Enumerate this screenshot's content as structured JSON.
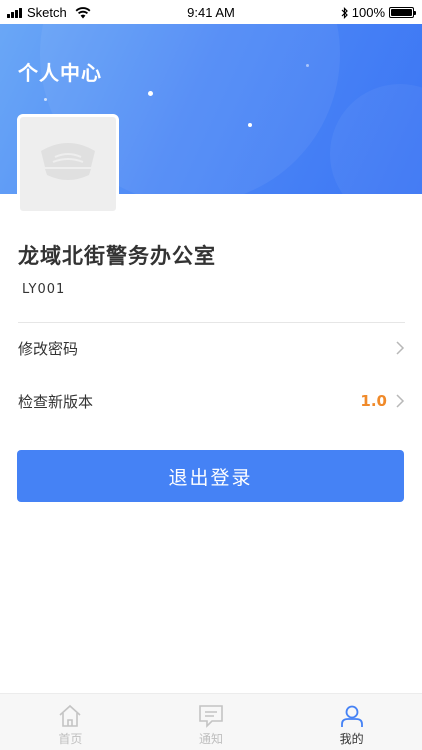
{
  "status_bar": {
    "carrier": "Sketch",
    "time": "9:41 AM",
    "battery": "100%",
    "battery_level": 1.0
  },
  "header": {
    "title": "个人中心"
  },
  "profile": {
    "avatar_icon": "police-cap-icon",
    "org_name": "龙域北街警务办公室",
    "org_code": "LY001"
  },
  "menu": {
    "change_password": "修改密码",
    "check_version": "检查新版本",
    "version_value": "1.0"
  },
  "logout": {
    "label": "退出登录"
  },
  "tabs": [
    {
      "label": "首页",
      "icon": "home-icon"
    },
    {
      "label": "通知",
      "icon": "message-icon"
    },
    {
      "label": "我的",
      "icon": "user-icon"
    }
  ],
  "colors": {
    "accent": "#4582f5",
    "version": "#f08a2a",
    "header_start": "#6aa7f6",
    "header_end": "#3b75f4"
  }
}
